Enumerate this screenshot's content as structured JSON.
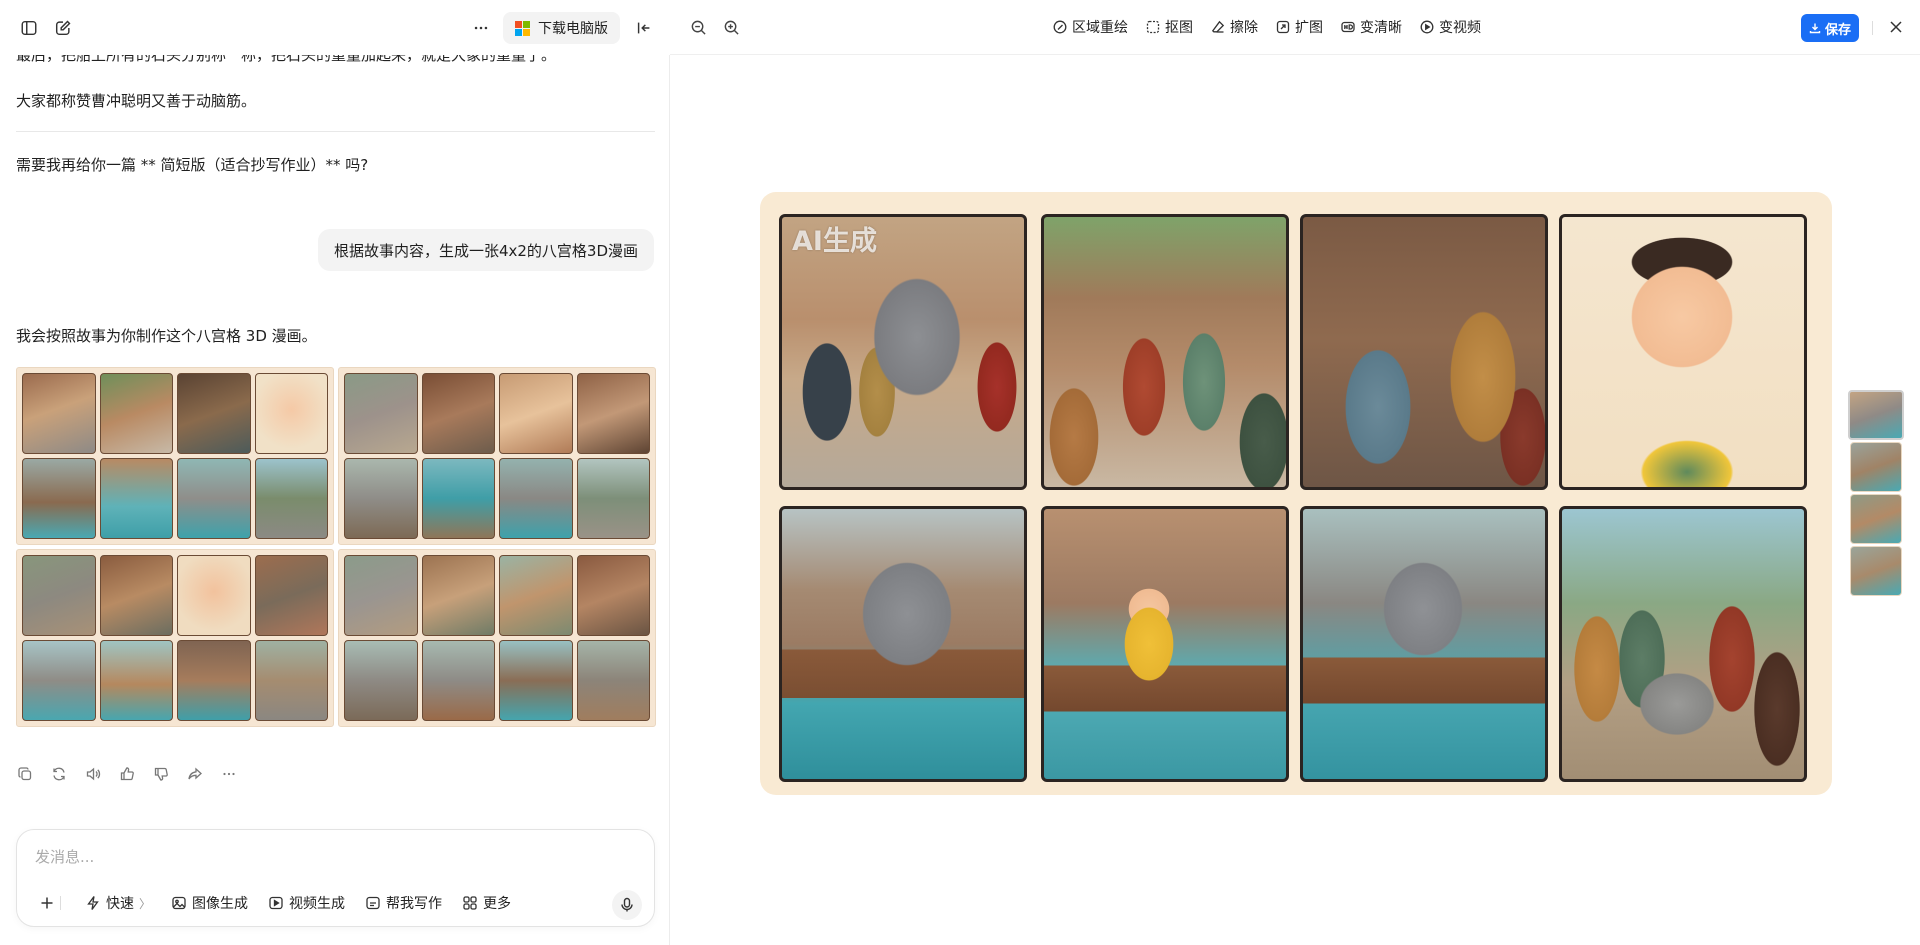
{
  "left": {
    "download_btn": "下载电脑版",
    "messages": {
      "cut_line": "最后，把船上所有的石头分别称一称，把石头的重量加起来，就是大象的重量了。",
      "praise": "大家都称赞曹冲聪明又善于动脑筋。",
      "offer": "需要我再给你一篇 ** 简短版（适合抄写作业）** 吗?",
      "user_prompt": "根据故事内容，生成一张4x2的八宫格3D漫画",
      "reply": "我会按照故事为你制作这个八宫格 3D 漫画。"
    },
    "composer": {
      "placeholder": "发消息...",
      "chips": {
        "fast": "快速",
        "image_gen": "图像生成",
        "video_gen": "视频生成",
        "write": "帮我写作",
        "more": "更多"
      }
    }
  },
  "right": {
    "tools": {
      "inpaint": "区域重绘",
      "cutout": "抠图",
      "erase": "擦除",
      "expand": "扩图",
      "upscale": "变清晰",
      "to_video": "变视频"
    },
    "save": "保存",
    "watermark": "AI生成"
  }
}
